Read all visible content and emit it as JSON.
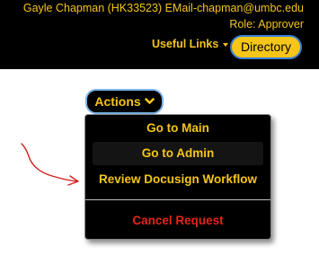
{
  "header": {
    "user_line": "Gayle Chapman (HK33523) EMail-chapman@umbc.edu",
    "role_line": "Role: Approver",
    "useful_links_label": "Useful Links",
    "directory_label": "Directory"
  },
  "actions": {
    "button_label": "Actions",
    "menu": {
      "items": [
        {
          "label": "Go to Main"
        },
        {
          "label": "Go to Admin"
        },
        {
          "label": "Review Docusign Workflow"
        }
      ],
      "cancel_label": "Cancel Request"
    }
  },
  "colors": {
    "accent_yellow": "#f5c518",
    "header_bg": "#000000",
    "cancel_red": "#e3261b",
    "focus_blue": "#3a7fd5",
    "annotation_red": "#d42020"
  }
}
